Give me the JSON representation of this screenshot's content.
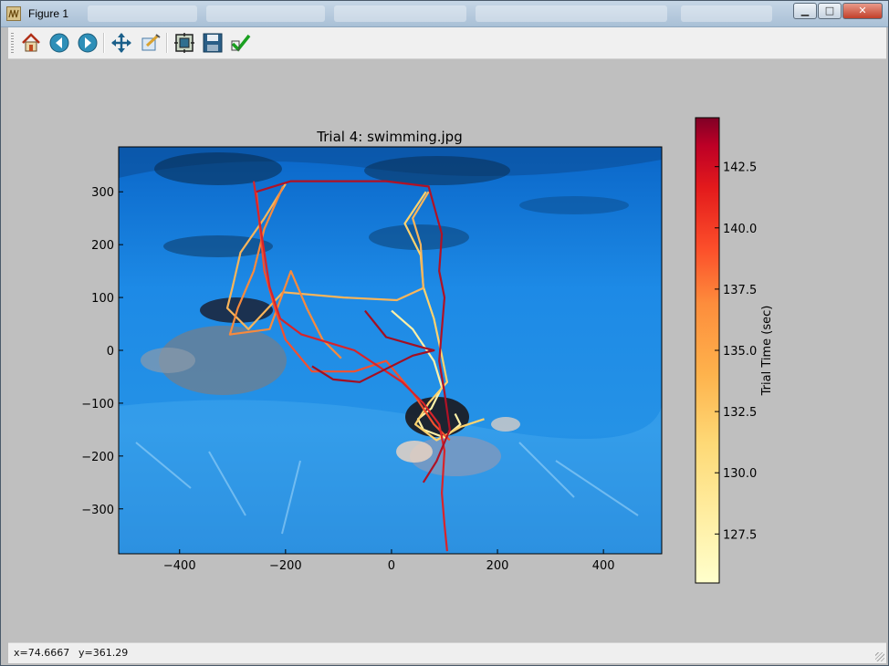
{
  "window": {
    "title": "Figure 1",
    "min_symbol": "▁",
    "max_symbol": "□",
    "close_symbol": "✕"
  },
  "toolbar": {
    "buttons": [
      {
        "name": "home",
        "icon": "home-icon"
      },
      {
        "name": "back",
        "icon": "back-arrow-icon"
      },
      {
        "name": "forward",
        "icon": "forward-arrow-icon"
      },
      {
        "name": "pan",
        "icon": "pan-arrows-icon"
      },
      {
        "name": "zoom",
        "icon": "zoom-rect-icon"
      },
      {
        "name": "subplots",
        "icon": "subplots-icon"
      },
      {
        "name": "save",
        "icon": "floppy-disk-icon"
      },
      {
        "name": "edit",
        "icon": "checkmark-icon"
      }
    ]
  },
  "status": {
    "x_readout": "x=74.6667",
    "y_readout": "y=361.29"
  },
  "chart_data": {
    "type": "line",
    "title": "Trial 4: swimming.jpg",
    "xlim": [
      -515,
      510
    ],
    "ylim": [
      -385,
      385
    ],
    "xticks": [
      -400,
      -200,
      0,
      200,
      400
    ],
    "yticks": [
      300,
      200,
      100,
      0,
      -100,
      -200,
      -300
    ],
    "xtick_labels": [
      "−400",
      "−200",
      "0",
      "200",
      "400"
    ],
    "ytick_labels": [
      "300",
      "200",
      "100",
      "0",
      "−100",
      "−200",
      "−300"
    ],
    "background_image": "underwater-swimmers-photo",
    "grid": false,
    "colorbar": {
      "label": "Trial Time (sec)",
      "cmap": "YlOrRd",
      "range": [
        125.5,
        144.5
      ],
      "ticks": [
        142.5,
        140.0,
        137.5,
        135.0,
        132.5,
        130.0,
        127.5
      ],
      "tick_labels": [
        "142.5",
        "140.0",
        "137.5",
        "135.0",
        "132.5",
        "130.0",
        "127.5"
      ]
    },
    "series": [
      {
        "color": "#fff1a8",
        "points": [
          [
            0,
            75
          ],
          [
            40,
            40
          ],
          [
            80,
            -20
          ],
          [
            95,
            -70
          ],
          [
            75,
            -110
          ],
          [
            50,
            -130
          ],
          [
            60,
            -150
          ],
          [
            100,
            -165
          ],
          [
            130,
            -140
          ],
          [
            120,
            -120
          ]
        ]
      },
      {
        "color": "#ffd36e",
        "points": [
          [
            65,
            300
          ],
          [
            25,
            240
          ],
          [
            55,
            180
          ],
          [
            60,
            120
          ],
          [
            80,
            60
          ],
          [
            95,
            -10
          ],
          [
            105,
            -60
          ],
          [
            70,
            -100
          ],
          [
            45,
            -140
          ],
          [
            85,
            -170
          ],
          [
            130,
            -145
          ],
          [
            175,
            -130
          ]
        ]
      },
      {
        "color": "#f9b55a",
        "points": [
          [
            -200,
            315
          ],
          [
            -240,
            250
          ],
          [
            -285,
            185
          ],
          [
            -300,
            120
          ],
          [
            -310,
            80
          ],
          [
            -270,
            40
          ],
          [
            -205,
            110
          ],
          [
            -90,
            100
          ],
          [
            10,
            95
          ],
          [
            60,
            118
          ],
          [
            55,
            200
          ],
          [
            40,
            250
          ],
          [
            70,
            300
          ]
        ]
      },
      {
        "color": "#f98a3c",
        "points": [
          [
            -205,
            310
          ],
          [
            -240,
            230
          ],
          [
            -260,
            150
          ],
          [
            -290,
            80
          ],
          [
            -305,
            30
          ],
          [
            -230,
            40
          ],
          [
            -190,
            150
          ],
          [
            -160,
            80
          ],
          [
            -130,
            20
          ],
          [
            -95,
            -15
          ]
        ]
      },
      {
        "color": "#f4502e",
        "points": [
          [
            -255,
            300
          ],
          [
            -240,
            150
          ],
          [
            -220,
            80
          ],
          [
            -200,
            20
          ],
          [
            -150,
            -40
          ],
          [
            -70,
            -40
          ],
          [
            -10,
            -20
          ],
          [
            40,
            -80
          ],
          [
            80,
            -140
          ],
          [
            110,
            -170
          ]
        ]
      },
      {
        "color": "#d8242a",
        "points": [
          [
            -260,
            320
          ],
          [
            -250,
            250
          ],
          [
            -230,
            120
          ],
          [
            -210,
            60
          ],
          [
            -170,
            30
          ],
          [
            -70,
            0
          ],
          [
            20,
            -60
          ],
          [
            60,
            -100
          ],
          [
            90,
            -140
          ],
          [
            100,
            -190
          ],
          [
            95,
            -270
          ],
          [
            100,
            -330
          ],
          [
            105,
            -380
          ]
        ]
      },
      {
        "color": "#b01226",
        "points": [
          [
            -255,
            300
          ],
          [
            -190,
            320
          ],
          [
            -10,
            320
          ],
          [
            70,
            310
          ],
          [
            95,
            220
          ],
          [
            90,
            150
          ],
          [
            100,
            100
          ],
          [
            95,
            40
          ],
          [
            90,
            -20
          ],
          [
            100,
            -80
          ],
          [
            110,
            -150
          ],
          [
            85,
            -210
          ],
          [
            60,
            -250
          ]
        ]
      },
      {
        "color": "#a30f22",
        "points": [
          [
            -50,
            75
          ],
          [
            -10,
            25
          ],
          [
            60,
            5
          ],
          [
            80,
            0
          ],
          [
            40,
            -10
          ],
          [
            -20,
            -40
          ],
          [
            -60,
            -60
          ],
          [
            -110,
            -55
          ],
          [
            -150,
            -30
          ]
        ]
      }
    ]
  }
}
